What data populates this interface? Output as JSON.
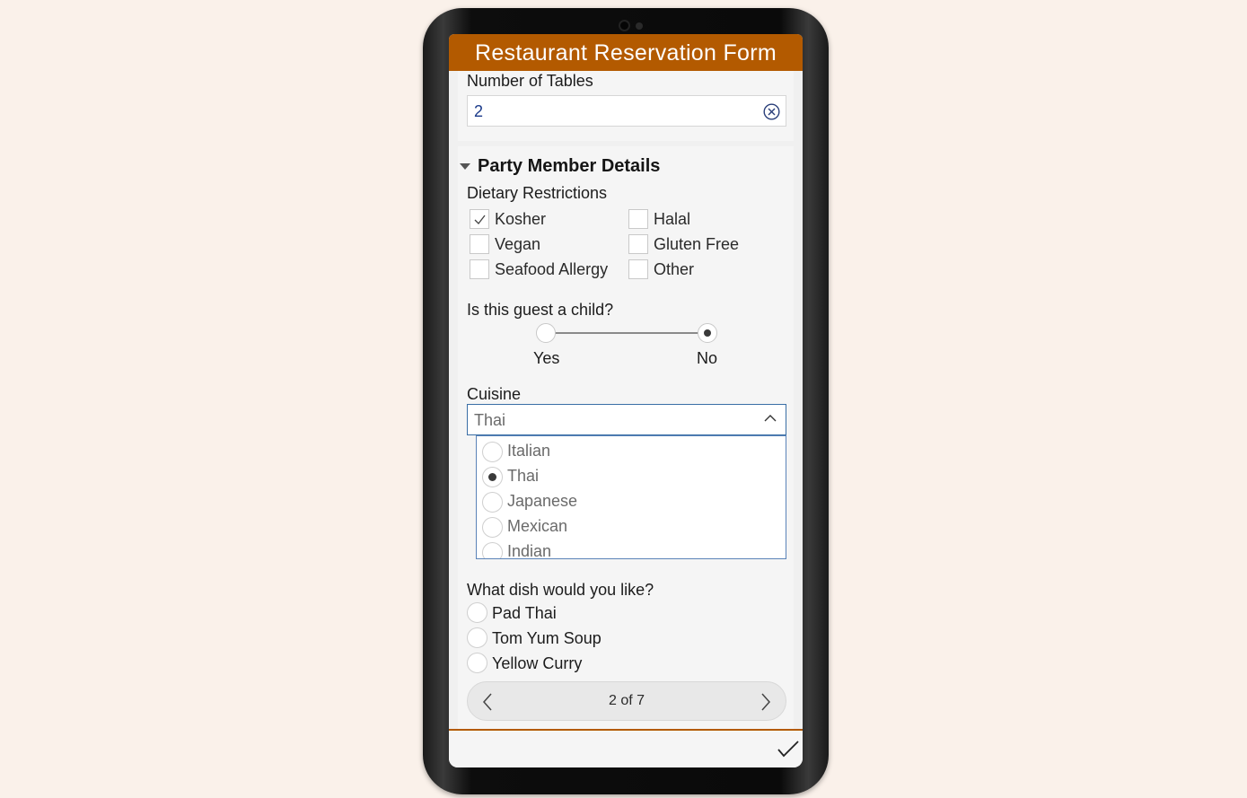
{
  "form": {
    "title": "Restaurant Reservation Form"
  },
  "tables": {
    "label": "Number of Tables",
    "value": "2"
  },
  "party": {
    "section_title": "Party Member Details",
    "dietary_label": "Dietary Restrictions",
    "dietary_options": [
      {
        "label": "Kosher",
        "checked": true
      },
      {
        "label": "Halal",
        "checked": false
      },
      {
        "label": "Vegan",
        "checked": false
      },
      {
        "label": "Gluten Free",
        "checked": false
      },
      {
        "label": "Seafood Allergy",
        "checked": false
      },
      {
        "label": "Other",
        "checked": false
      }
    ],
    "child_question": "Is this guest a child?",
    "child_options": [
      "Yes",
      "No"
    ],
    "child_selected": "No",
    "cuisine_label": "Cuisine",
    "cuisine_value": "Thai",
    "cuisine_options": [
      "Italian",
      "Thai",
      "Japanese",
      "Mexican",
      "Indian"
    ],
    "dish_question": "What dish would you like?",
    "dish_options": [
      "Pad Thai",
      "Tom Yum Soup",
      "Yellow Curry"
    ]
  },
  "pager": {
    "text": "2 of 7"
  },
  "icons": {
    "clear": "circle-x-icon",
    "collapse": "caret-down-icon",
    "check": "checkmark-icon",
    "chevron_up": "chevron-up-icon",
    "prev": "chevron-left-icon",
    "next": "chevron-right-icon",
    "submit": "checkmark-icon"
  },
  "colors": {
    "accent": "#b35a00",
    "value_text": "#1a3a8a",
    "focus_border": "#3a6ea5"
  }
}
